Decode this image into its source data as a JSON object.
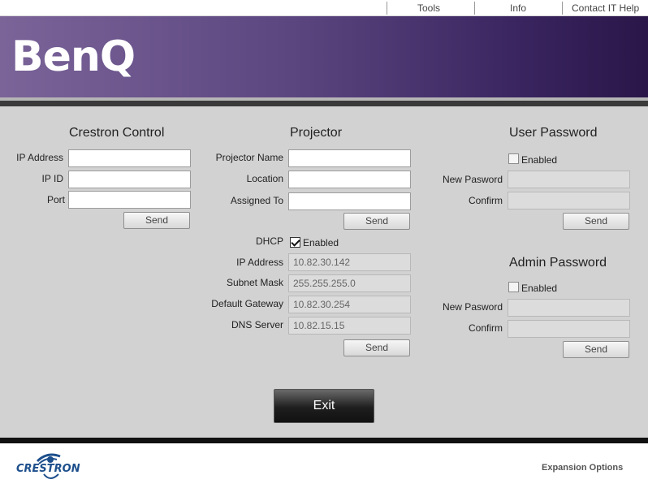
{
  "menu": {
    "tools": "Tools",
    "info": "Info",
    "help": "Contact IT Help"
  },
  "brand": {
    "logo": "BenQ"
  },
  "crestron": {
    "title": "Crestron Control",
    "ip_address_label": "IP Address",
    "ip_address_value": "",
    "ip_id_label": "IP ID",
    "ip_id_value": "",
    "port_label": "Port",
    "port_value": "",
    "send": "Send"
  },
  "projector": {
    "title": "Projector",
    "name_label": "Projector Name",
    "name_value": "",
    "location_label": "Location",
    "location_value": "",
    "assigned_label": "Assigned To",
    "assigned_value": "",
    "send": "Send",
    "dhcp_label": "DHCP",
    "dhcp_enabled": "Enabled",
    "dhcp_checked": true,
    "ip_label": "IP Address",
    "ip_value": "10.82.30.142",
    "mask_label": "Subnet Mask",
    "mask_value": "255.255.255.0",
    "gateway_label": "Default Gateway",
    "gateway_value": "10.82.30.254",
    "dns_label": "DNS Server",
    "dns_value": "10.82.15.15",
    "send2": "Send"
  },
  "user_password": {
    "title": "User Password",
    "enabled": "Enabled",
    "new_label": "New Pasword",
    "confirm_label": "Confirm",
    "send": "Send"
  },
  "admin_password": {
    "title": "Admin Password",
    "enabled": "Enabled",
    "new_label": "New Pasword",
    "confirm_label": "Confirm",
    "send": "Send"
  },
  "exit": "Exit",
  "footer": {
    "crestron_logo": "CRESTRON",
    "expansion": "Expansion Options"
  },
  "colors": {
    "banner_start": "#7a6498",
    "banner_end": "#2a1648",
    "panel": "#d2d2d2"
  }
}
